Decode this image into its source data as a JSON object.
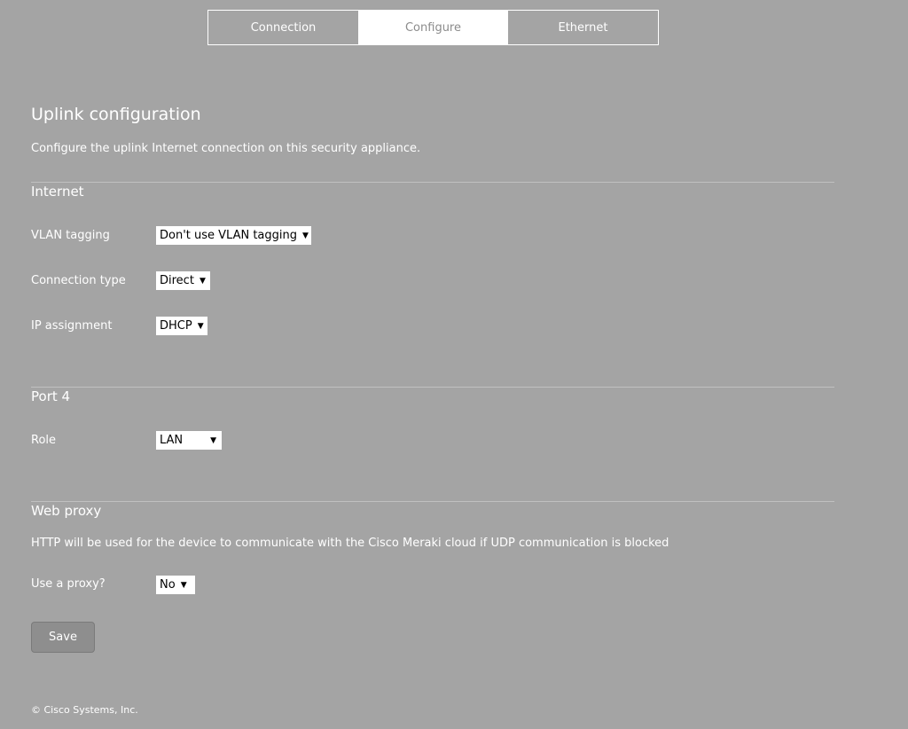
{
  "tabs": [
    {
      "label": "Connection",
      "active": false
    },
    {
      "label": "Configure",
      "active": true
    },
    {
      "label": "Ethernet",
      "active": false
    }
  ],
  "page": {
    "title": "Uplink configuration",
    "description": "Configure the uplink Internet connection on this security appliance."
  },
  "internet": {
    "title": "Internet",
    "vlan_tagging": {
      "label": "VLAN tagging",
      "value": "Don't use VLAN tagging"
    },
    "connection_type": {
      "label": "Connection type",
      "value": "Direct"
    },
    "ip_assignment": {
      "label": "IP assignment",
      "value": "DHCP"
    }
  },
  "port4": {
    "title": "Port 4",
    "role": {
      "label": "Role",
      "value": "LAN"
    }
  },
  "web_proxy": {
    "title": "Web proxy",
    "description": "HTTP will be used for the device to communicate with the Cisco Meraki cloud if UDP communication is blocked",
    "use_proxy": {
      "label": "Use a proxy?",
      "value": "No"
    }
  },
  "save_label": "Save",
  "caret": "▼",
  "footer": "© Cisco Systems, Inc.",
  "colors": {
    "background": "#a4a4a4",
    "active_tab_bg": "#ffffff",
    "active_tab_text": "#8c8c8c",
    "button_bg": "#8e8e8e",
    "text": "#ffffff"
  },
  "icons": {
    "dropdown": "caret-down-icon"
  }
}
